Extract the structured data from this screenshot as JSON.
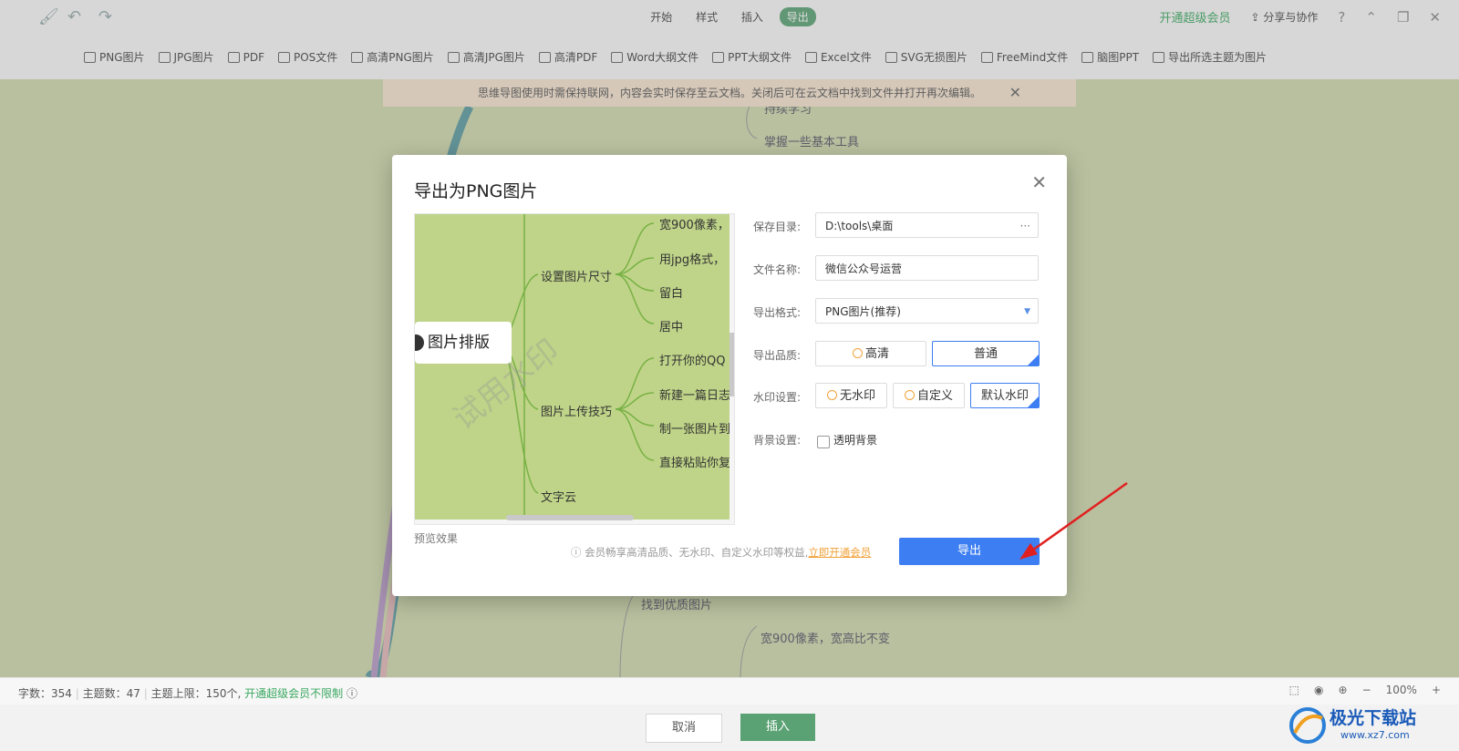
{
  "toolbar": {
    "tabs": [
      "开始",
      "样式",
      "插入",
      "导出"
    ],
    "active_tab": "导出",
    "vip_link": "开通超级会员",
    "share": "分享与协作",
    "help": "?"
  },
  "export_bar": {
    "items": [
      "PNG图片",
      "JPG图片",
      "PDF",
      "POS文件",
      "高清PNG图片",
      "高清JPG图片",
      "高清PDF",
      "Word大纲文件",
      "PPT大纲文件",
      "Excel文件",
      "SVG无损图片",
      "FreeMind文件",
      "脑图PPT",
      "导出所选主题为图片"
    ]
  },
  "notice": {
    "text": "思维导图使用时需保持联网，内容会实时保存至云文档。关闭后可在云文档中找到文件并打开再次编辑。"
  },
  "background_nodes": {
    "node1": "持续学习",
    "node2": "掌握一些基本工具",
    "node3": "找到优质图片",
    "node4": "宽900像素，宽高比不变"
  },
  "dialog": {
    "title": "导出为PNG图片",
    "preview_label": "预览效果",
    "preview": {
      "root": "图片排版",
      "branch1": "设置图片尺寸",
      "branch2": "图片上传技巧",
      "branch3": "文字云",
      "leaf1": "宽900像素，",
      "leaf2": "用jpg格式，",
      "leaf3": "留白",
      "leaf4": "居中",
      "leaf5": "打开你的QQ",
      "leaf6": "新建一篇日志",
      "leaf7": "制一张图片到",
      "leaf8": "直接粘贴你复",
      "watermark": "试用水印"
    },
    "save_dir_label": "保存目录:",
    "save_dir_value": "D:\\tools\\桌面",
    "save_dir_more": "···",
    "file_name_label": "文件名称:",
    "file_name_value": "微信公众号运营",
    "format_label": "导出格式:",
    "format_value": "PNG图片(推荐)",
    "quality_label": "导出品质:",
    "quality_options": [
      "高清",
      "普通"
    ],
    "quality_selected": "普通",
    "watermark_label": "水印设置:",
    "watermark_options": [
      "无水印",
      "自定义",
      "默认水印"
    ],
    "watermark_selected": "默认水印",
    "background_label": "背景设置:",
    "transparent_label": "透明背景",
    "transparent_checked": false,
    "promo_text": "会员畅享高清品质、无水印、自定义水印等权益,",
    "promo_link": "立即开通会员",
    "export_button": "导出"
  },
  "status": {
    "word_count": "字数：354",
    "topic_count": "主题数：47",
    "topic_limit": "主题上限：150个,",
    "vip_unlimited": "开通超级会员不限制",
    "zoom": "100%",
    "zoom_minus": "−",
    "zoom_plus": "+"
  },
  "bottom": {
    "cancel": "取消",
    "insert": "插入"
  },
  "watermark_logo": {
    "name": "极光下载站",
    "url": "www.xz7.com"
  },
  "colors": {
    "accent_blue": "#3d7ef3",
    "accent_green": "#5aa273",
    "canvas_bg": "#cfd8ad",
    "arrow_red": "#e02020"
  }
}
